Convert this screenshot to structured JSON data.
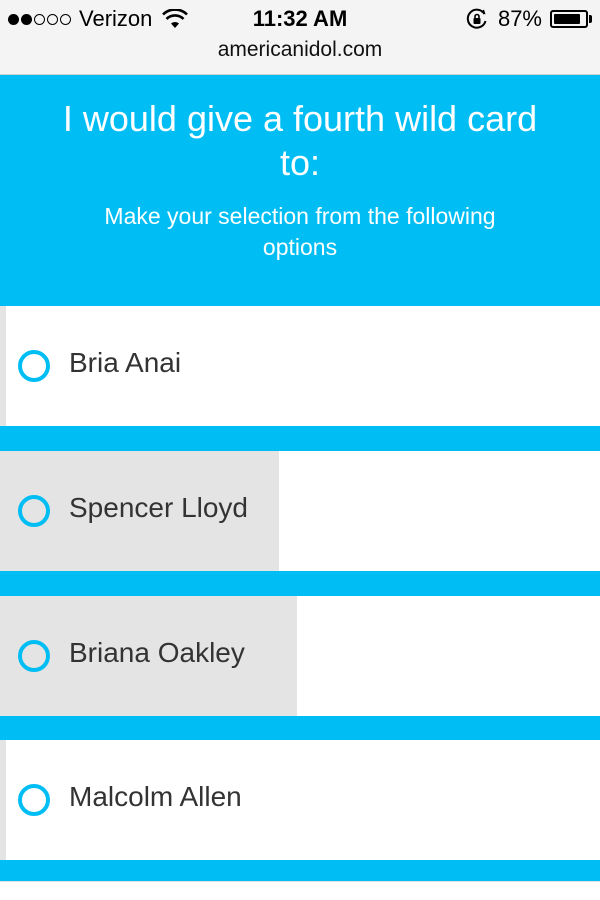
{
  "status_bar": {
    "signal_dots_filled": 2,
    "signal_dots_total": 5,
    "carrier": "Verizon",
    "time": "11:32 AM",
    "battery_percent": "87%",
    "battery_level": 0.87,
    "icons": [
      "wifi-icon",
      "rotation-lock-icon",
      "battery-icon"
    ]
  },
  "browser": {
    "url": "americanidol.com"
  },
  "poll": {
    "title": "I would give a fourth wild card to:",
    "subtitle": "Make your selection from the following options",
    "options": [
      {
        "label": "Bria Anai",
        "result_fraction": 0.0
      },
      {
        "label": "Spencer Lloyd",
        "result_fraction": 0.46
      },
      {
        "label": "Briana Oakley",
        "result_fraction": 0.49
      },
      {
        "label": "Malcolm Allen",
        "result_fraction": 0.0
      }
    ]
  },
  "colors": {
    "accent": "#00bef4",
    "option_bg": "#ffffff",
    "progress_fill": "#e4e4e4",
    "text_dark": "#333333"
  }
}
